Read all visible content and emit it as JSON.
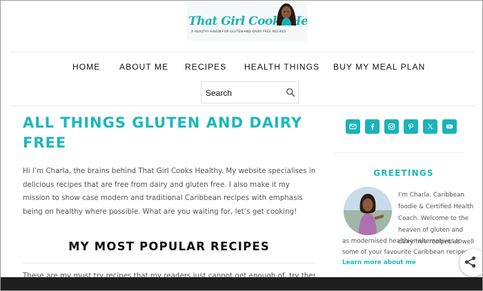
{
  "header": {
    "logo_title": "That Girl Cooks Healthy",
    "logo_tagline": "A HEALTHY HAVEN FOR GLUTEN AND DAIRY FREE RECIPES"
  },
  "nav": {
    "items": [
      {
        "label": "HOME"
      },
      {
        "label": "ABOUT ME"
      },
      {
        "label": "RECIPES"
      },
      {
        "label": "HEALTH THINGS"
      },
      {
        "label": "BUY MY MEAL PLAN"
      }
    ]
  },
  "search": {
    "placeholder": "Search"
  },
  "main": {
    "title": "ALL THINGS GLUTEN AND DAIRY FREE",
    "intro": "Hi I’m Charla, the brains behind That Girl Cooks Healthy. My website specialises in delicious recipes that are free from dairy and gluten free. I also make it my mission to show case modern and traditional Caribbean recipes with emphasis being on healthy where possible. What are you waiting for, let’s get cooking!",
    "section_heading": "MY MOST POPULAR RECIPES",
    "section_sub": "These are my must try recipes that my readers just cannot get enough of, try them!"
  },
  "sidebar": {
    "social_icons": [
      "email-icon",
      "facebook-icon",
      "instagram-icon",
      "pinterest-icon",
      "x-icon",
      "youtube-icon"
    ],
    "greetings_heading": "GREETINGS",
    "bio_part1": "I’m Charla. Caribbean foodie & Certified Health Coach. Welcome to the heaven of gluten and dairy free recipes as well",
    "bio_part2": "as modernised healthier alternatives to some of your favourite Caribbean recipes.",
    "learn_more": "Learn more about me"
  },
  "colors": {
    "accent": "#1bb7bd",
    "text": "#555555",
    "bottom_bar": "#1e1e1e"
  }
}
